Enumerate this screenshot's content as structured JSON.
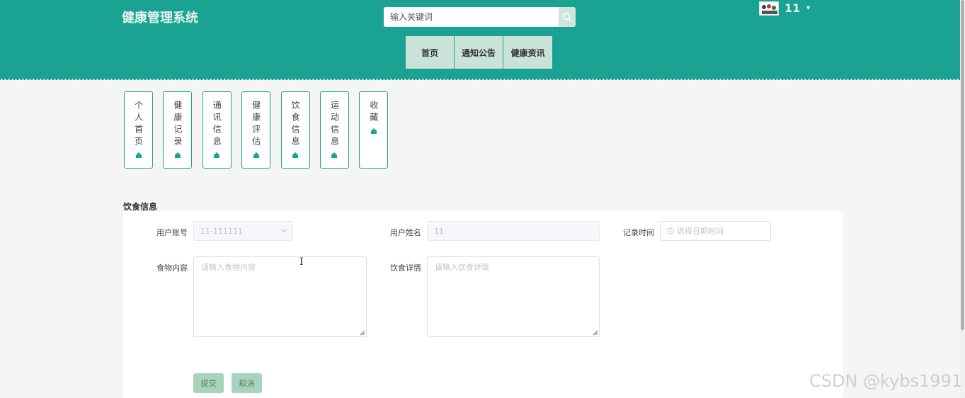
{
  "header": {
    "title": "健康管理系统",
    "search_placeholder": "输入关键词",
    "username": "11",
    "nav": [
      "首页",
      "通知公告",
      "健康资讯"
    ]
  },
  "sidebar": {
    "cards": [
      "个人首页",
      "健康记录",
      "通讯信息",
      "健康评估",
      "饮食信息",
      "运动信息",
      "收藏"
    ]
  },
  "form": {
    "section_title": "饮食信息",
    "account_label": "用户账号",
    "account_value": "11-111111",
    "name_label": "用户姓名",
    "name_value": "11",
    "time_label": "记录时间",
    "time_placeholder": "选择日期时间",
    "food_label": "食物内容",
    "food_placeholder": "请输入食物内容",
    "detail_label": "饮食详情",
    "detail_placeholder": "请输入饮食详情",
    "submit": "提交",
    "cancel": "取消"
  },
  "watermark": "CSDN @kybs1991",
  "colors": {
    "primary": "#1aa393",
    "nav_bg": "#c9e3d8",
    "button_bg": "#a8d4be"
  }
}
